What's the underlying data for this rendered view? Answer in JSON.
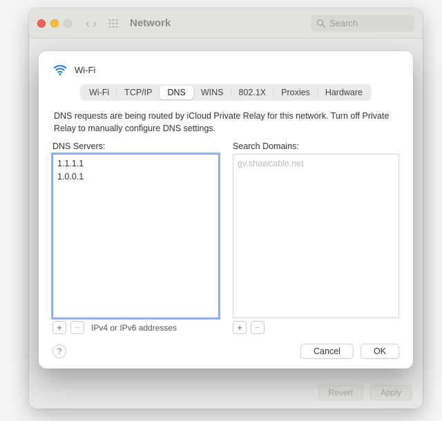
{
  "window": {
    "title": "Network",
    "search_placeholder": "Search",
    "footer": {
      "revert": "Revert",
      "apply": "Apply"
    }
  },
  "sheet": {
    "title": "Wi-Fi",
    "tabs": [
      {
        "label": "Wi-Fi",
        "active": false
      },
      {
        "label": "TCP/IP",
        "active": false
      },
      {
        "label": "DNS",
        "active": true
      },
      {
        "label": "WINS",
        "active": false
      },
      {
        "label": "802.1X",
        "active": false
      },
      {
        "label": "Proxies",
        "active": false
      },
      {
        "label": "Hardware",
        "active": false
      }
    ],
    "info": "DNS requests are being routed by iCloud Private Relay for this network. Turn off Private Relay to manually configure DNS settings.",
    "dns": {
      "label": "DNS Servers:",
      "items": [
        "1.1.1.1",
        "1.0.0.1"
      ],
      "hint": "IPv4 or IPv6 addresses"
    },
    "search_domains": {
      "label": "Search Domains:",
      "placeholder": "gv.shawcable.net",
      "items": []
    },
    "buttons": {
      "cancel": "Cancel",
      "ok": "OK"
    }
  }
}
